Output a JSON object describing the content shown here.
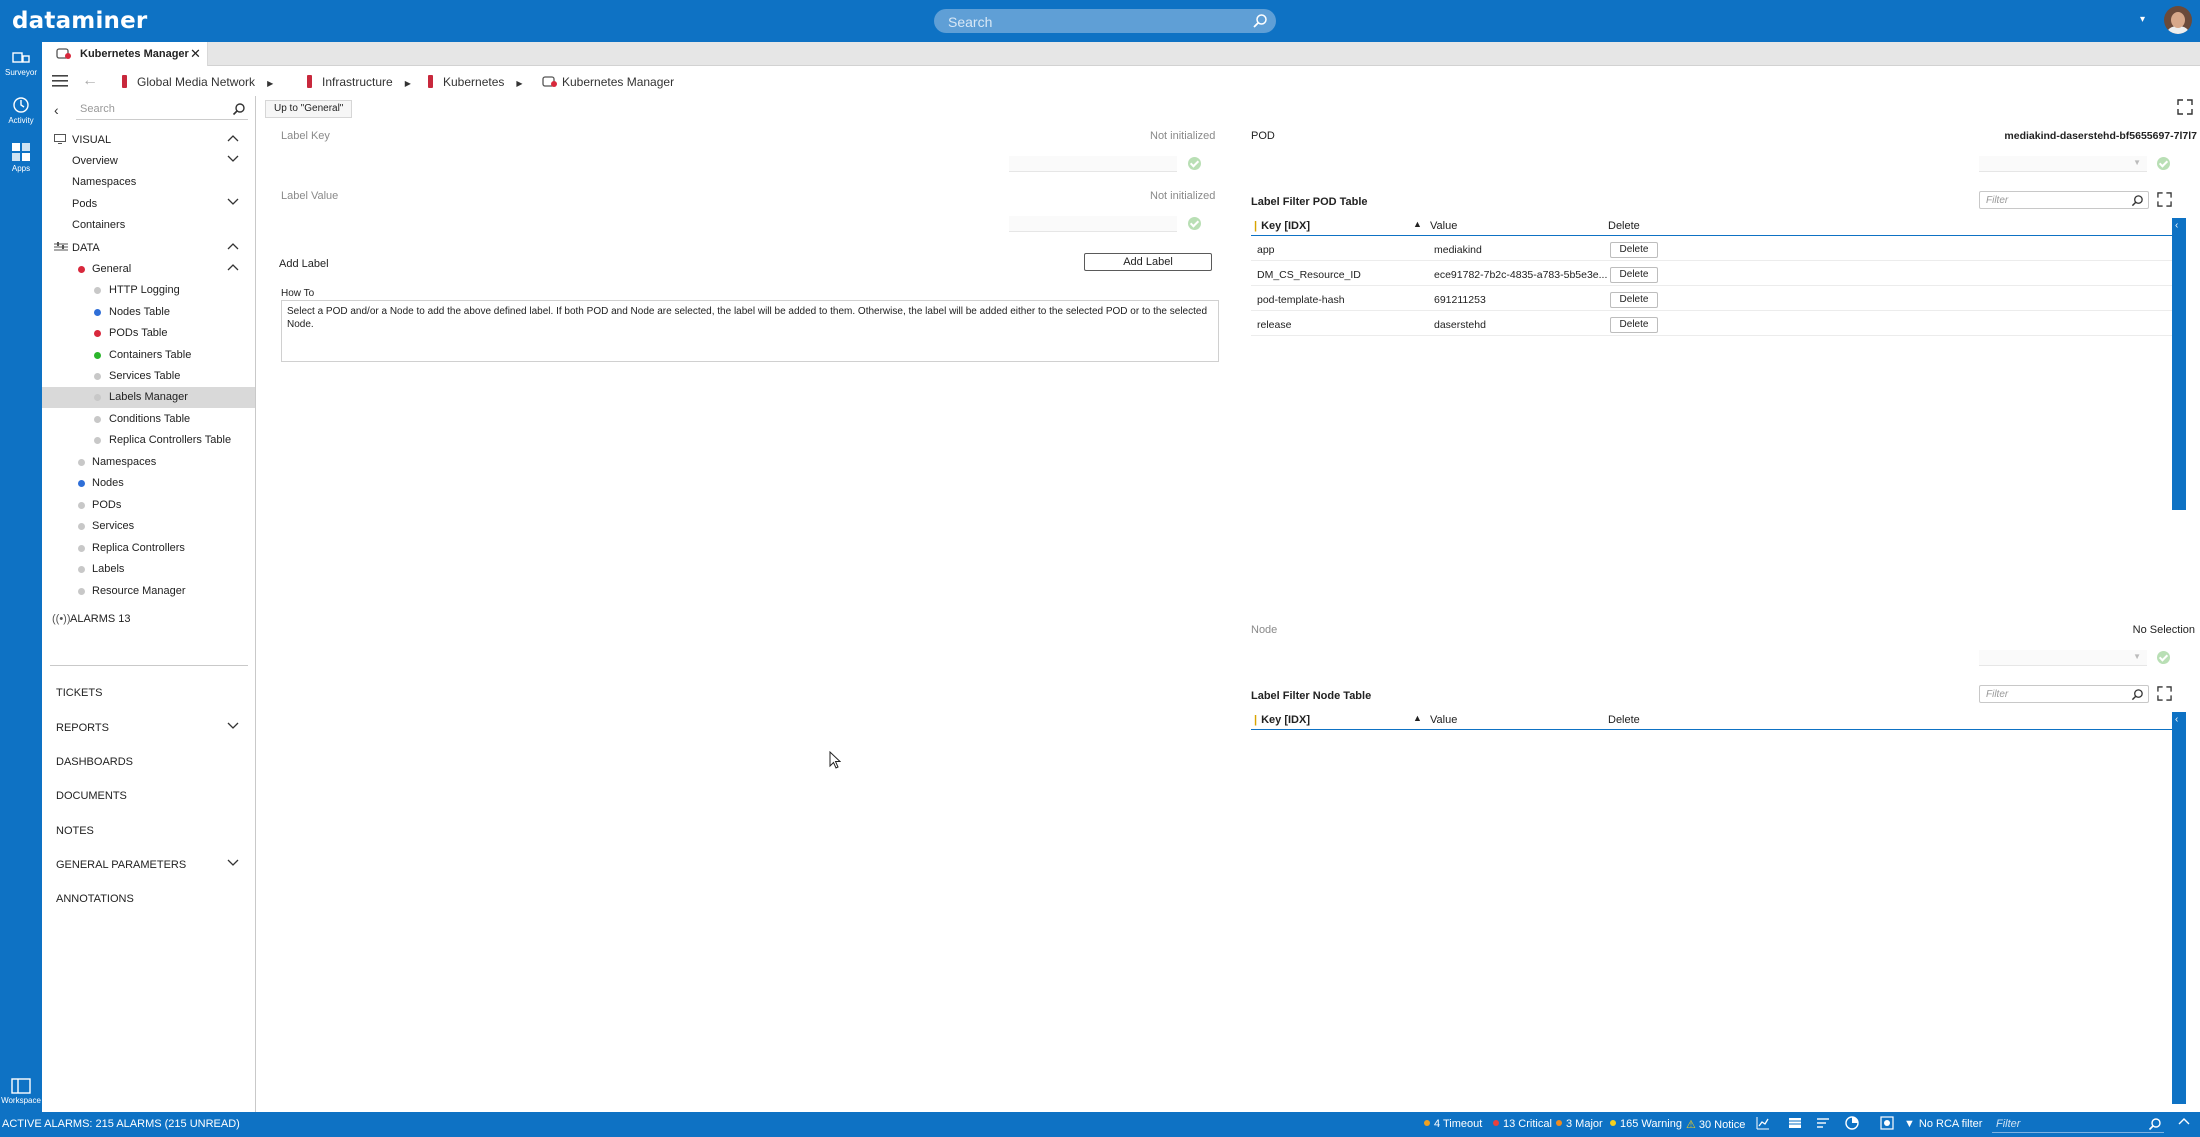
{
  "app": {
    "logo": "dataminer",
    "search_placeholder": "Search",
    "user_menu_caret": "▾"
  },
  "rail": {
    "items": [
      {
        "label": "Surveyor",
        "icon": "surveyor-icon"
      },
      {
        "label": "Activity",
        "icon": "activity-icon"
      },
      {
        "label": "Apps",
        "icon": "apps-icon"
      }
    ],
    "workspace": "Workspace"
  },
  "tab": {
    "label": "Kubernetes Manager",
    "close": "✕"
  },
  "breadcrumb": [
    {
      "label": "Global Media Network"
    },
    {
      "label": "Infrastructure"
    },
    {
      "label": "Kubernetes"
    },
    {
      "label": "Kubernetes Manager"
    }
  ],
  "nav": {
    "search_placeholder": "Search",
    "visual_header": "VISUAL",
    "visual_items": [
      "Overview",
      "Namespaces",
      "Pods",
      "Containers"
    ],
    "data_header": "DATA",
    "general": "General",
    "general_items": [
      {
        "label": "HTTP Logging",
        "color": "#c8c8c8"
      },
      {
        "label": "Nodes Table",
        "color": "#2f6fd8"
      },
      {
        "label": "PODs Table",
        "color": "#d8283c"
      },
      {
        "label": "Containers Table",
        "color": "#2bb52b"
      },
      {
        "label": "Services Table",
        "color": "#c8c8c8"
      },
      {
        "label": "Labels Manager",
        "color": "#c8c8c8"
      },
      {
        "label": "Conditions Table",
        "color": "#c8c8c8"
      },
      {
        "label": "Replica Controllers Table",
        "color": "#c8c8c8"
      }
    ],
    "data_items": [
      {
        "label": "Namespaces",
        "color": "#c8c8c8"
      },
      {
        "label": "Nodes",
        "color": "#2f6fd8"
      },
      {
        "label": "PODs",
        "color": "#c8c8c8"
      },
      {
        "label": "Services",
        "color": "#c8c8c8"
      },
      {
        "label": "Replica Controllers",
        "color": "#c8c8c8"
      },
      {
        "label": "Labels",
        "color": "#c8c8c8"
      },
      {
        "label": "Resource Manager",
        "color": "#c8c8c8"
      }
    ],
    "alarms": "ALARMS 13",
    "sections": [
      "TICKETS",
      "REPORTS",
      "DASHBOARDS",
      "DOCUMENTS",
      "NOTES",
      "GENERAL PARAMETERS",
      "ANNOTATIONS"
    ]
  },
  "main": {
    "up_button": "Up to \"General\"",
    "label_key": "Label Key",
    "label_key_status": "Not initialized",
    "label_value": "Label Value",
    "label_value_status": "Not initialized",
    "add_label": "Add Label",
    "add_label_button": "Add Label",
    "how_to": "How To",
    "how_to_text": "Select a POD and/or a Node to add the above defined label. If both POD and Node are selected, the label will be added to them. Otherwise, the label will be added either to the selected POD or to the selected Node.",
    "pod_label": "POD",
    "pod_value": "mediakind-daserstehd-bf5655697-7l7l7",
    "pod_table_title": "Label Filter POD Table",
    "filter_placeholder": "Filter",
    "columns": {
      "key": "Key [IDX]",
      "value": "Value",
      "delete": "Delete"
    },
    "pod_rows": [
      {
        "key": "app",
        "value": "mediakind",
        "action": "Delete"
      },
      {
        "key": "DM_CS_Resource_ID",
        "value": "ece91782-7b2c-4835-a783-5b5e3e...",
        "action": "Delete"
      },
      {
        "key": "pod-template-hash",
        "value": "691211253",
        "action": "Delete"
      },
      {
        "key": "release",
        "value": "daserstehd",
        "action": "Delete"
      }
    ],
    "node_label": "Node",
    "node_value": "No Selection",
    "node_table_title": "Label Filter Node Table"
  },
  "status": {
    "active_alarms": "ACTIVE ALARMS: 215 ALARMS (215 UNREAD)",
    "counters": [
      {
        "label": "4 Timeout",
        "color": "#f0a020"
      },
      {
        "label": "13 Critical",
        "color": "#e8403c"
      },
      {
        "label": "3 Major",
        "color": "#f28c1e"
      },
      {
        "label": "165 Warning",
        "color": "#f5d01e"
      },
      {
        "label": "30 Notice",
        "color": "#f5d01e"
      }
    ],
    "rca": "No RCA filter",
    "filter_placeholder": "Filter"
  }
}
